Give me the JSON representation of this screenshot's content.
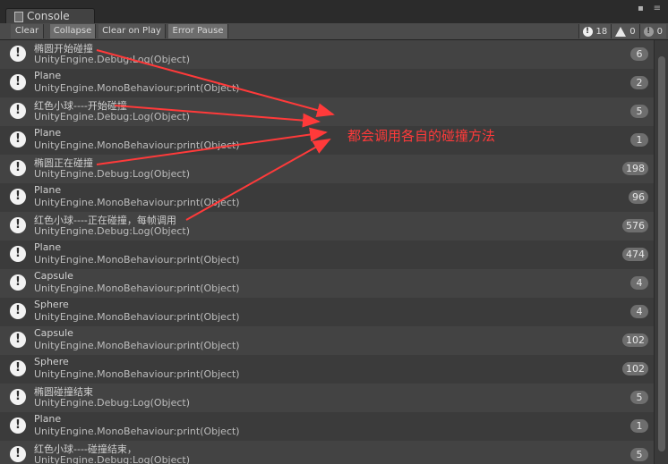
{
  "window": {
    "tab_label": "Console"
  },
  "toolbar": {
    "buttons": [
      {
        "label": "Clear",
        "active": false
      },
      {
        "label": "Collapse",
        "active": true
      },
      {
        "label": "Clear on Play",
        "active": false
      },
      {
        "label": "Error Pause",
        "active": true
      }
    ],
    "counters": {
      "log": "18",
      "warning": "0",
      "error": "0"
    }
  },
  "rows": [
    {
      "msg": "椭圆开始碰撞",
      "src": "UnityEngine.Debug:Log(Object)",
      "count": "6"
    },
    {
      "msg": "Plane",
      "src": "UnityEngine.MonoBehaviour:print(Object)",
      "count": "2"
    },
    {
      "msg": "红色小球----开始碰撞",
      "src": "UnityEngine.Debug:Log(Object)",
      "count": "5"
    },
    {
      "msg": "Plane",
      "src": "UnityEngine.MonoBehaviour:print(Object)",
      "count": "1"
    },
    {
      "msg": "椭圆正在碰撞",
      "src": "UnityEngine.Debug:Log(Object)",
      "count": "198"
    },
    {
      "msg": "Plane",
      "src": "UnityEngine.MonoBehaviour:print(Object)",
      "count": "96"
    },
    {
      "msg": "红色小球----正在碰撞，每帧调用",
      "src": "UnityEngine.Debug:Log(Object)",
      "count": "576"
    },
    {
      "msg": "Plane",
      "src": "UnityEngine.MonoBehaviour:print(Object)",
      "count": "474"
    },
    {
      "msg": "Capsule",
      "src": "UnityEngine.MonoBehaviour:print(Object)",
      "count": "4"
    },
    {
      "msg": "Sphere",
      "src": "UnityEngine.MonoBehaviour:print(Object)",
      "count": "4"
    },
    {
      "msg": "Capsule",
      "src": "UnityEngine.MonoBehaviour:print(Object)",
      "count": "102"
    },
    {
      "msg": "Sphere",
      "src": "UnityEngine.MonoBehaviour:print(Object)",
      "count": "102"
    },
    {
      "msg": "椭圆碰撞结束",
      "src": "UnityEngine.Debug:Log(Object)",
      "count": "5"
    },
    {
      "msg": "Plane",
      "src": "UnityEngine.MonoBehaviour:print(Object)",
      "count": "1"
    },
    {
      "msg": "红色小球----碰撞结束，",
      "src": "UnityEngine.Debug:Log(Object)",
      "count": "5"
    }
  ],
  "annotation": {
    "text": "都会调用各自的碰撞方法",
    "color": "#ff3a3a"
  }
}
